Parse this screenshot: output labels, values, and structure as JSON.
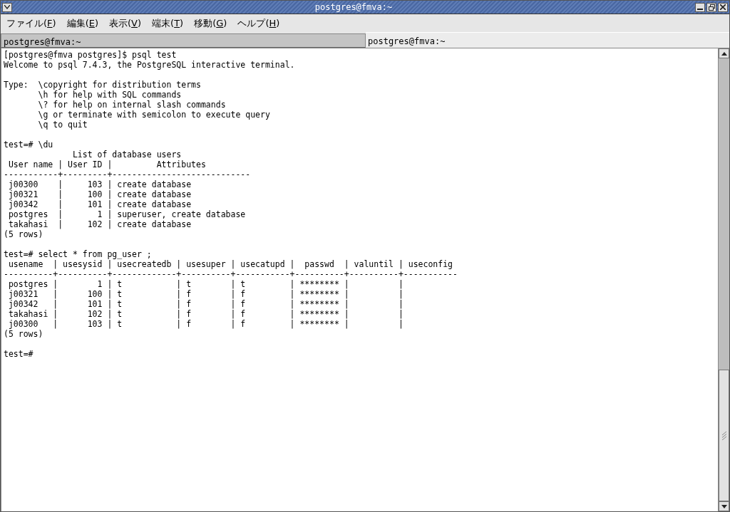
{
  "window": {
    "title": "postgres@fmva:~"
  },
  "menu": [
    {
      "text_before": "ファイル(",
      "mnemonic": "F",
      "text_after": ")"
    },
    {
      "text_before": "編集(",
      "mnemonic": "E",
      "text_after": ")"
    },
    {
      "text_before": "表示(",
      "mnemonic": "V",
      "text_after": ")"
    },
    {
      "text_before": "端末(",
      "mnemonic": "T",
      "text_after": ")"
    },
    {
      "text_before": "移動(",
      "mnemonic": "G",
      "text_after": ")"
    },
    {
      "text_before": "ヘルプ(",
      "mnemonic": "H",
      "text_after": ")"
    }
  ],
  "tabs": [
    {
      "label": "postgres@fmva:~",
      "selected": false
    },
    {
      "label": "postgres@fmva:~",
      "selected": true
    }
  ],
  "terminal": {
    "blocks": [
      [
        "[postgres@fmva postgres]$ psql test",
        "Welcome to psql 7.4.3, the PostgreSQL interactive terminal."
      ],
      [
        "Type:  \\copyright for distribution terms",
        "       \\h for help with SQL commands",
        "       \\? for help on internal slash commands",
        "       \\g or terminate with semicolon to execute query",
        "       \\q to quit"
      ],
      [
        "test=# \\du",
        "              List of database users",
        " User name | User ID |         Attributes",
        "-----------+---------+----------------------------",
        " j00300    |     103 | create database",
        " j00321    |     100 | create database",
        " j00342    |     101 | create database",
        " postgres  |       1 | superuser, create database",
        " takahasi  |     102 | create database",
        "(5 rows)"
      ],
      [
        "test=# select * from pg_user ;",
        " usename  | usesysid | usecreatedb | usesuper | usecatupd |  passwd  | valuntil | useconfig",
        "----------+----------+-------------+----------+-----------+----------+----------+-----------",
        " postgres |        1 | t           | t        | t         | ******** |          |",
        " j00321   |      100 | t           | f        | f         | ******** |          |",
        " j00342   |      101 | t           | f        | f         | ******** |          |",
        " takahasi |      102 | t           | f        | f         | ******** |          |",
        " j00300   |      103 | t           | f        | f         | ******** |          |",
        "(5 rows)"
      ],
      [
        "test=#"
      ]
    ]
  }
}
